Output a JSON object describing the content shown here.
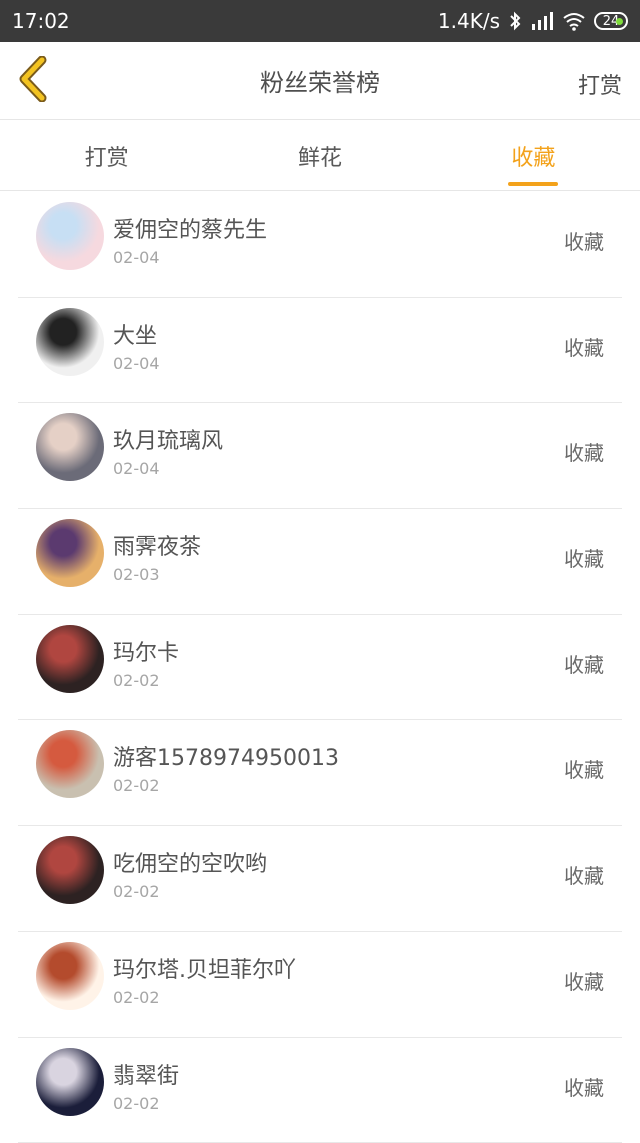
{
  "status_bar": {
    "time": "17:02",
    "network_speed": "1.4K/s",
    "battery": "24",
    "icons": [
      "bluetooth-icon",
      "signal-icon",
      "wifi-icon",
      "battery-icon"
    ]
  },
  "header": {
    "title": "粉丝荣誉榜",
    "right_action": "打赏",
    "back_icon": "chevron-left-icon"
  },
  "tabs": [
    {
      "label": "打赏",
      "active": false
    },
    {
      "label": "鲜花",
      "active": false
    },
    {
      "label": "收藏",
      "active": true
    }
  ],
  "accent_color": "#f3a21b",
  "list": [
    {
      "name": "爱佣空的蔡先生",
      "date": "02-04",
      "action": "收藏",
      "avatar_colors": [
        "#f6d9df",
        "#c7dff4"
      ]
    },
    {
      "name": "大坐",
      "date": "02-04",
      "action": "收藏",
      "avatar_colors": [
        "#f0f0f0",
        "#222222"
      ]
    },
    {
      "name": "玖月琉璃风",
      "date": "02-04",
      "action": "收藏",
      "avatar_colors": [
        "#6b6b78",
        "#e5d0c6"
      ]
    },
    {
      "name": "雨霁夜茶",
      "date": "02-03",
      "action": "收藏",
      "avatar_colors": [
        "#e6b06a",
        "#5b3a6f"
      ]
    },
    {
      "name": "玛尔卡",
      "date": "02-02",
      "action": "收藏",
      "avatar_colors": [
        "#2d2222",
        "#b04640"
      ]
    },
    {
      "name": "游客1578974950013",
      "date": "02-02",
      "action": "收藏",
      "avatar_colors": [
        "#c9c0b0",
        "#d55a3f"
      ]
    },
    {
      "name": "吃佣空的空吹哟",
      "date": "02-02",
      "action": "收藏",
      "avatar_colors": [
        "#2d2222",
        "#b04640"
      ]
    },
    {
      "name": "玛尔塔.贝坦菲尔吖",
      "date": "02-02",
      "action": "收藏",
      "avatar_colors": [
        "#fff3e8",
        "#b44b2d"
      ]
    },
    {
      "name": "翡翠街",
      "date": "02-02",
      "action": "收藏",
      "avatar_colors": [
        "#1b1e3a",
        "#d9d4e0"
      ]
    }
  ]
}
